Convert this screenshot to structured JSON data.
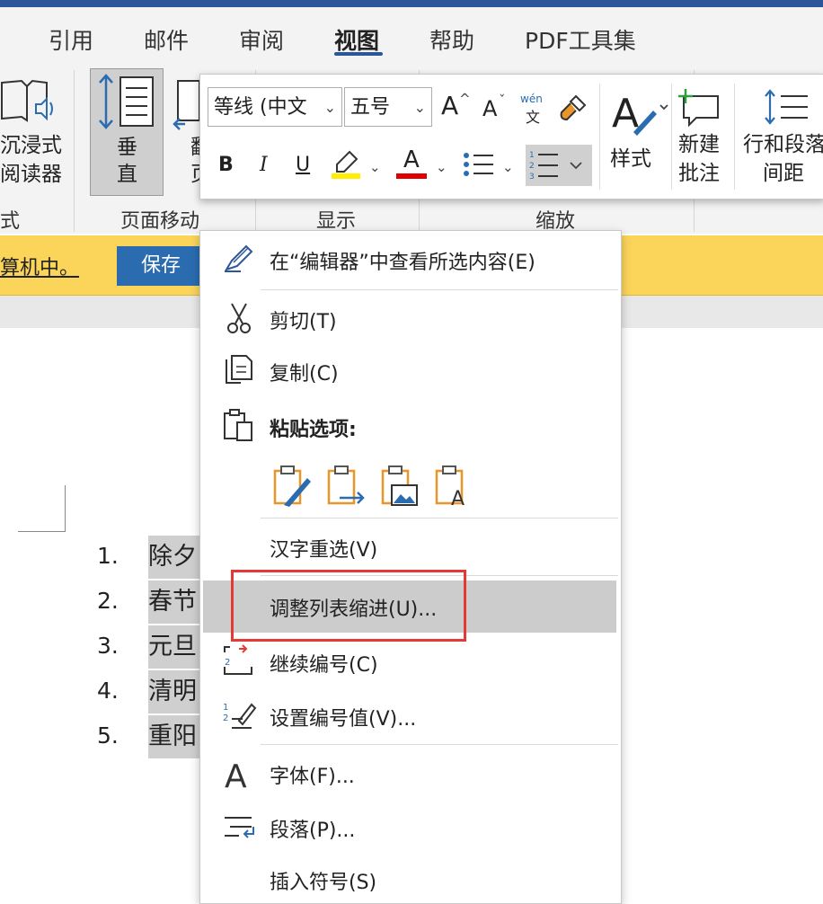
{
  "ribbon_tabs": [
    {
      "label": "引用",
      "active": false
    },
    {
      "label": "邮件",
      "active": false
    },
    {
      "label": "审阅",
      "active": false
    },
    {
      "label": "视图",
      "active": true
    },
    {
      "label": "帮助",
      "active": false
    },
    {
      "label": "PDF工具集",
      "active": false
    }
  ],
  "ribbon": {
    "immersive_reader_line1": "沉浸式",
    "immersive_reader_line2": "阅读器",
    "vertical_line1": "垂",
    "vertical_line2": "直",
    "side_to_side_line1": "翻",
    "side_to_side_line2": "页",
    "group_immersive": "式",
    "group_page_movement": "页面移动",
    "group_show": "显示",
    "group_zoom": "缩放"
  },
  "info_bar": {
    "text": "算机中。",
    "save_button": "保存"
  },
  "mini_toolbar": {
    "font_name": "等线 (中文",
    "font_size": "五号",
    "grow_font": "A",
    "shrink_font": "A",
    "phonetic_top": "wén",
    "phonetic_bottom": "文",
    "bold": "B",
    "italic": "I",
    "underline": "U",
    "font_color_letter": "A",
    "styles_label": "样式",
    "new_comment_line1": "新建",
    "new_comment_line2": "批注",
    "line_spacing_line1": "行和段落",
    "line_spacing_line2": "间距",
    "highlight_color": "#ffee00",
    "font_color": "#e00000"
  },
  "document": {
    "list": [
      {
        "num": "1.",
        "text": "除夕"
      },
      {
        "num": "2.",
        "text": "春节"
      },
      {
        "num": "3.",
        "text": "元旦"
      },
      {
        "num": "4.",
        "text": "清明"
      },
      {
        "num": "5.",
        "text": "重阳"
      }
    ]
  },
  "context_menu": {
    "view_in_editor": "在“编辑器”中查看所选内容(E)",
    "cut": "剪切(T)",
    "copy": "复制(C)",
    "paste_options": "粘贴选项:",
    "reconvert": "汉字重选(V)",
    "adjust_list_indent": "调整列表缩进(U)...",
    "continue_numbering": "继续编号(C)",
    "set_numbering_value": "设置编号值(V)...",
    "font": "字体(F)...",
    "paragraph": "段落(P)...",
    "insert_symbol": "插入符号(S)"
  },
  "colors": {
    "accent_blue": "#2b579a",
    "info_bar_yellow": "#fbd55a",
    "highlight_red_box": "#e53935",
    "paste_icon_orange": "#e8952a"
  }
}
